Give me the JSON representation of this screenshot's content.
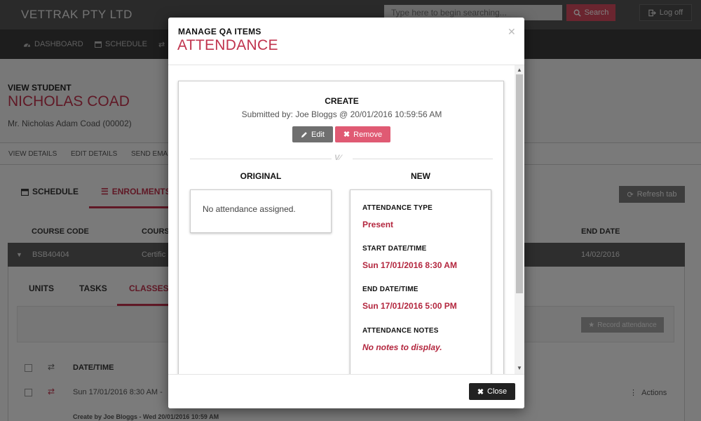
{
  "app": {
    "brand": "VETTRAK PTY LTD",
    "search_placeholder": "Type here to begin searching...",
    "search_button": "Search",
    "logoff_button": "Log off"
  },
  "nav": {
    "items": [
      {
        "label": "DASHBOARD",
        "icon": "dashboard-icon"
      },
      {
        "label": "SCHEDULE",
        "icon": "calendar-icon"
      }
    ]
  },
  "student": {
    "heading": "VIEW STUDENT",
    "name": "NICHOLAS COAD",
    "subtitle": "Mr. Nicholas Adam Coad (00002)",
    "subnav": [
      "VIEW DETAILS",
      "EDIT DETAILS",
      "SEND EMAI"
    ]
  },
  "tabs": {
    "schedule": "SCHEDULE",
    "enrolments": "ENROLMENTS",
    "refresh": "Refresh tab"
  },
  "table": {
    "headers": {
      "course_code": "COURSE CODE",
      "course": "COURS",
      "end_date": "END DATE"
    },
    "row": {
      "course_code": "BSB40404",
      "course": "Certific",
      "end_date": "14/02/2016"
    }
  },
  "inner_tabs": [
    "UNITS",
    "TASKS",
    "CLASSES"
  ],
  "classes": {
    "record_button": "Record attendance",
    "date_header": "DATE/TIME",
    "row_text": "Sun 17/01/2016 8:30 AM -",
    "actions": "Actions",
    "created_by": "Create by Joe Bloggs - Wed 20/01/2016 10:59 AM"
  },
  "modal": {
    "supertitle": "MANAGE QA ITEMS",
    "title": "ATTENDANCE",
    "card": {
      "heading": "CREATE",
      "submitted": "Submitted by: Joe Bloggs @ 20/01/2016 10:59:56 AM",
      "edit_button": "Edit",
      "remove_button": "Remove",
      "original_title": "ORIGINAL",
      "new_title": "NEW",
      "original_text": "No attendance assigned.",
      "fields": [
        {
          "label": "ATTENDANCE TYPE",
          "value": "Present"
        },
        {
          "label": "START DATE/TIME",
          "value": "Sun 17/01/2016 8:30 AM"
        },
        {
          "label": "END DATE/TIME",
          "value": "Sun 17/01/2016 5:00 PM"
        },
        {
          "label": "ATTENDANCE NOTES",
          "value": "No notes to display."
        }
      ]
    },
    "close_button": "Close"
  },
  "colors": {
    "accent": "#c0334d",
    "value_red": "#b3263e",
    "remove": "#e05a73",
    "edit": "#6f6f6f"
  }
}
